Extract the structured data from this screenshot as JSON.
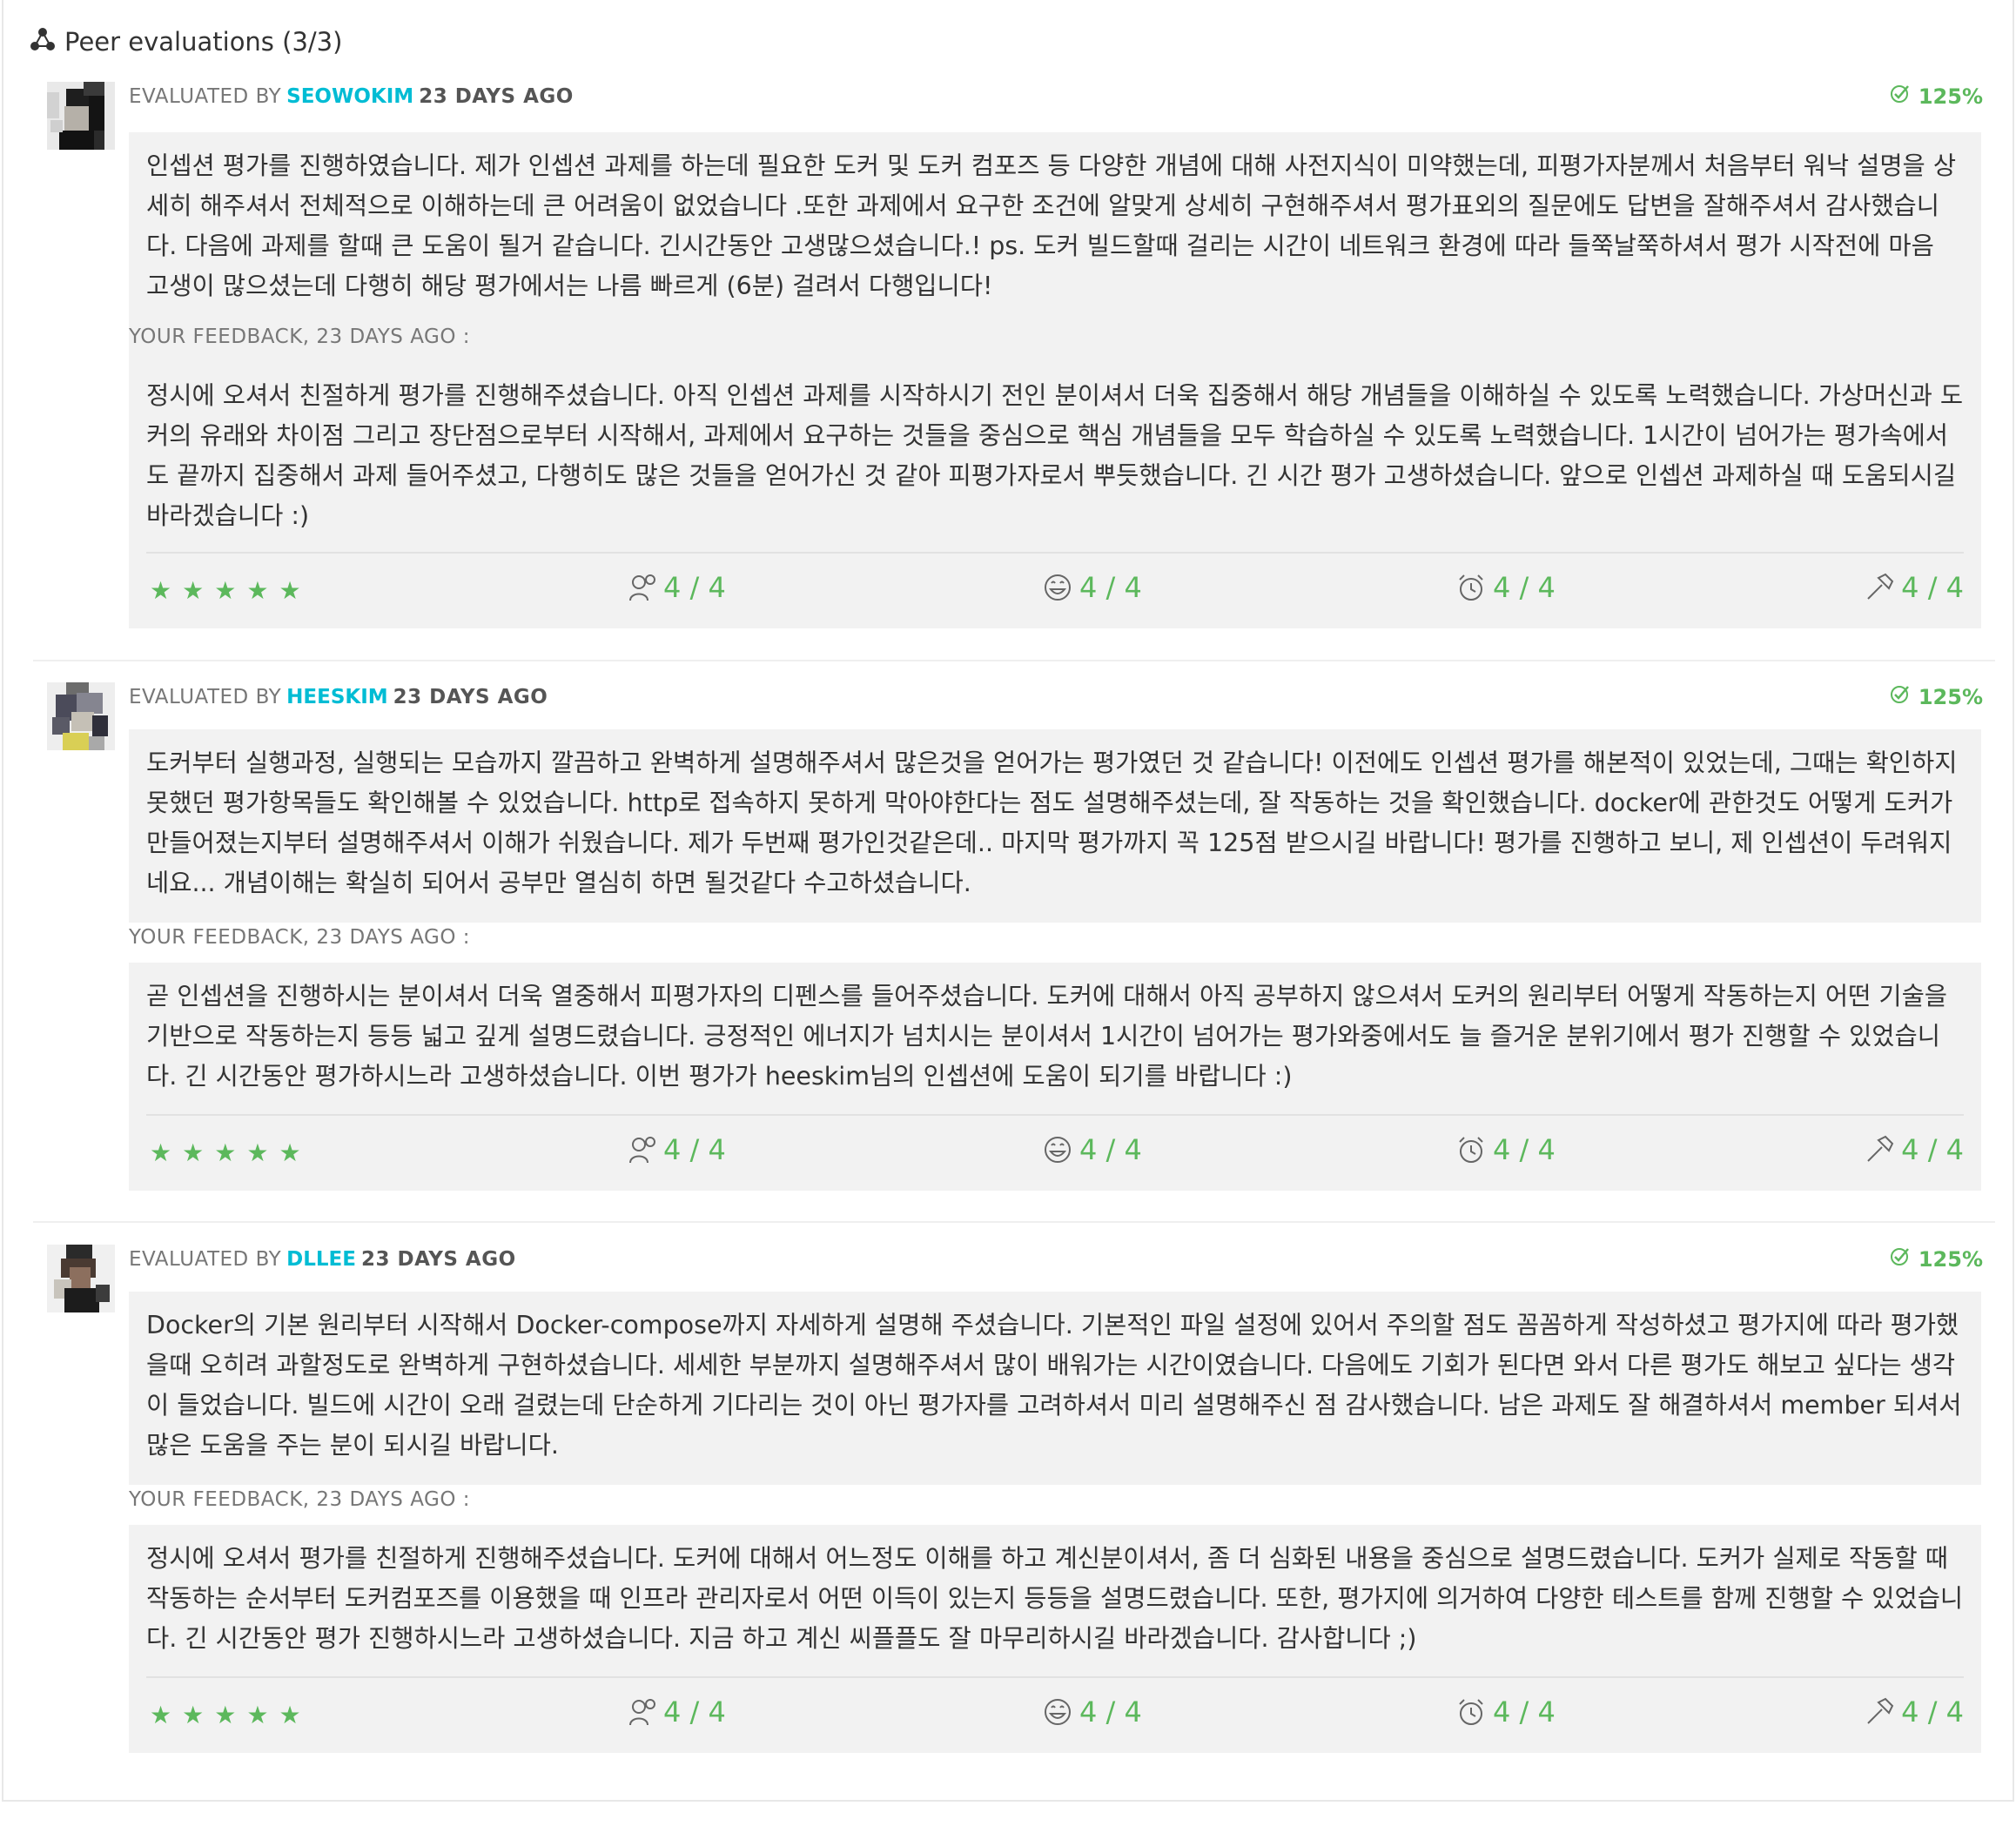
{
  "header": {
    "icon": "network-icon",
    "title": "Peer evaluations (3/3)"
  },
  "colors": {
    "accent_green": "#5cb85c",
    "login_cyan": "#00bcd4",
    "box_background": "#f2f2f2"
  },
  "evaluations": [
    {
      "evaluated_by_label": "EVALUATED BY",
      "login": "SEOWOKIM",
      "when": "23 DAYS AGO",
      "percent": "125%",
      "comment": "인셉션 평가를 진행하였습니다. 제가 인셉션 과제를 하는데 필요한 도커 및 도커 컴포즈 등 다양한 개념에 대해 사전지식이 미약했는데, 피평가자분께서 처음부터 워낙 설명을 상세히 해주셔서 전체적으로 이해하는데 큰 어려움이 없었습니다 .또한 과제에서 요구한 조건에 알맞게 상세히 구현해주셔서 평가표외의 질문에도 답변을 잘해주셔서 감사했습니다. 다음에 과제를 할때 큰 도움이 될거 같습니다. 긴시간동안 고생많으셨습니다.! ps. 도커 빌드할때 걸리는 시간이 네트워크 환경에 따라 들쭉날쭉하셔서 평가 시작전에 마음 고생이 많으셨는데 다행히 해당 평가에서는 나름 빠르게 (6분) 걸려서 다행입니다!",
      "feedback_label": "YOUR FEEDBACK, 23 DAYS AGO :",
      "feedback": "정시에 오셔서 친절하게 평가를 진행해주셨습니다. 아직 인셉션 과제를 시작하시기 전인 분이셔서 더욱 집중해서 해당 개념들을 이해하실 수 있도록 노력했습니다. 가상머신과 도커의 유래와 차이점 그리고 장단점으로부터 시작해서, 과제에서 요구하는 것들을 중심으로 핵심 개념들을 모두 학습하실 수 있도록 노력했습니다. 1시간이 넘어가는 평가속에서도 끝까지 집중해서 과제 들어주셨고, 다행히도 많은 것들을 얻어가신 것 같아 피평가자로서 뿌듯했습니다. 긴 시간 평가 고생하셨습니다. 앞으로 인셉션 과제하실 때 도움되시길 바라겠습니다 :)",
      "stars": 5,
      "ratings": [
        {
          "icon": "interested-icon",
          "value": "4 / 4"
        },
        {
          "icon": "nice-smiley-icon",
          "value": "4 / 4"
        },
        {
          "icon": "punctuality-alarm-icon",
          "value": "4 / 4"
        },
        {
          "icon": "rigorous-hammer-icon",
          "value": "4 / 4"
        }
      ]
    },
    {
      "evaluated_by_label": "EVALUATED BY",
      "login": "HEESKIM",
      "when": "23 DAYS AGO",
      "percent": "125%",
      "comment": "도커부터 실행과정, 실행되는 모습까지 깔끔하고 완벽하게 설명해주셔서 많은것을 얻어가는 평가였던 것 같습니다! 이전에도 인셉션 평가를 해본적이 있었는데, 그때는 확인하지 못했던 평가항목들도 확인해볼 수 있었습니다. http로 접속하지 못하게 막아야한다는 점도 설명해주셨는데, 잘 작동하는 것을 확인했습니다. docker에 관한것도 어떻게 도커가 만들어졌는지부터 설명해주셔서 이해가 쉬웠습니다. 제가 두번째 평가인것같은데.. 마지막 평가까지 꼭 125점 받으시길 바랍니다! 평가를 진행하고 보니, 제 인셉션이 두려워지네요... 개념이해는 확실히 되어서 공부만 열심히 하면 될것같다 수고하셨습니다.",
      "feedback_label": "YOUR FEEDBACK, 23 DAYS AGO :",
      "feedback": "곧 인셉션을 진행하시는 분이셔서 더욱 열중해서 피평가자의 디펜스를 들어주셨습니다. 도커에 대해서 아직 공부하지 않으셔서 도커의 원리부터 어떻게 작동하는지 어떤 기술을 기반으로 작동하는지 등등 넓고 깊게 설명드렸습니다. 긍정적인 에너지가 넘치시는 분이셔서 1시간이 넘어가는 평가와중에서도 늘 즐거운 분위기에서 평가 진행할 수 있었습니다. 긴 시간동안 평가하시느라 고생하셨습니다. 이번 평가가 heeskim님의 인셉션에 도움이 되기를 바랍니다 :)",
      "stars": 5,
      "ratings": [
        {
          "icon": "interested-icon",
          "value": "4 / 4"
        },
        {
          "icon": "nice-smiley-icon",
          "value": "4 / 4"
        },
        {
          "icon": "punctuality-alarm-icon",
          "value": "4 / 4"
        },
        {
          "icon": "rigorous-hammer-icon",
          "value": "4 / 4"
        }
      ]
    },
    {
      "evaluated_by_label": "EVALUATED BY",
      "login": "DLLEE",
      "when": "23 DAYS AGO",
      "percent": "125%",
      "comment": "Docker의 기본 원리부터 시작해서 Docker-compose까지 자세하게 설명해 주셨습니다. 기본적인 파일 설정에 있어서 주의할 점도 꼼꼼하게 작성하셨고 평가지에 따라 평가했을때 오히려 과할정도로 완벽하게 구현하셨습니다. 세세한 부분까지 설명해주셔서 많이 배워가는 시간이였습니다. 다음에도 기회가 된다면 와서 다른 평가도 해보고 싶다는 생각이 들었습니다. 빌드에 시간이 오래 걸렸는데 단순하게 기다리는 것이 아닌 평가자를 고려하셔서 미리 설명해주신 점 감사했습니다. 남은 과제도 잘 해결하셔서 member 되셔서 많은 도움을 주는 분이 되시길 바랍니다.",
      "feedback_label": "YOUR FEEDBACK, 23 DAYS AGO :",
      "feedback": "정시에 오셔서 평가를 친절하게 진행해주셨습니다. 도커에 대해서 어느정도 이해를 하고 계신분이셔서, 좀 더 심화된 내용을 중심으로 설명드렸습니다. 도커가 실제로 작동할 때 작동하는 순서부터 도커컴포즈를 이용했을 때 인프라 관리자로서 어떤 이득이 있는지 등등을 설명드렸습니다. 또한, 평가지에 의거하여 다양한 테스트를 함께 진행할 수 있었습니다. 긴 시간동안 평가 진행하시느라 고생하셨습니다. 지금 하고 계신 씨플플도 잘 마무리하시길 바라겠습니다. 감사합니다 ;)",
      "stars": 5,
      "ratings": [
        {
          "icon": "interested-icon",
          "value": "4 / 4"
        },
        {
          "icon": "nice-smiley-icon",
          "value": "4 / 4"
        },
        {
          "icon": "punctuality-alarm-icon",
          "value": "4 / 4"
        },
        {
          "icon": "rigorous-hammer-icon",
          "value": "4 / 4"
        }
      ]
    }
  ]
}
